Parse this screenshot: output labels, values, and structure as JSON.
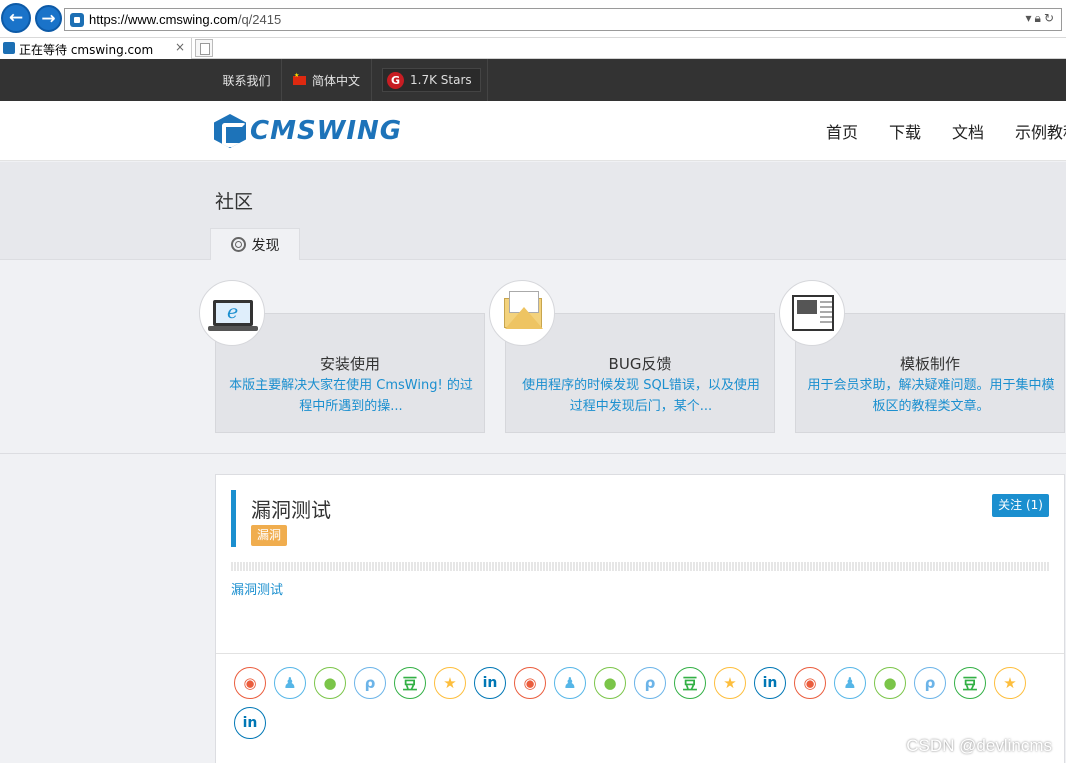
{
  "browser": {
    "url_prefix": "https://www.cmswing.com",
    "url_suffix": "/q/2415",
    "tab_title": "正在等待 cmswing.com",
    "tab_close": "×"
  },
  "topbar": {
    "contact": "联系我们",
    "language": "简体中文",
    "stars": "1.7K Stars",
    "gitee_letter": "G"
  },
  "header": {
    "logo_text": "CMSWING",
    "nav": [
      "首页",
      "下载",
      "文档",
      "示例教程"
    ]
  },
  "section": {
    "title": "社区",
    "tab": "发现"
  },
  "categories": [
    {
      "title": "安装使用",
      "desc": "本版主要解决大家在使用 CmsWing! 的过程中所遇到的操...",
      "icon": "laptop-icon"
    },
    {
      "title": "BUG反馈",
      "desc": "使用程序的时候发现 SQL错误，以及使用过程中发现后门，某个...",
      "icon": "mail-icon"
    },
    {
      "title": "模板制作",
      "desc": "用于会员求助，解决疑难问题。用于集中模板区的教程类文章。",
      "icon": "template-icon"
    }
  ],
  "post": {
    "title": "漏洞测试",
    "tag": "漏洞",
    "follow": "关注 (1)",
    "body": "漏洞测试"
  },
  "share_icons": [
    {
      "name": "weibo-icon",
      "glyph": "◉",
      "cls": "si-weibo"
    },
    {
      "name": "qq-icon",
      "glyph": "♟",
      "cls": "si-qq"
    },
    {
      "name": "wechat-icon",
      "glyph": "●",
      "cls": "si-wechat"
    },
    {
      "name": "tencent-weibo-icon",
      "glyph": "ρ",
      "cls": "si-tencent"
    },
    {
      "name": "douban-icon",
      "glyph": "豆",
      "cls": "si-douban"
    },
    {
      "name": "qzone-icon",
      "glyph": "★",
      "cls": "si-qzone"
    },
    {
      "name": "linkedin-icon",
      "glyph": "in",
      "cls": "si-linkedin"
    },
    {
      "name": "weibo-icon",
      "glyph": "◉",
      "cls": "si-weibo"
    },
    {
      "name": "qq-icon",
      "glyph": "♟",
      "cls": "si-qq"
    },
    {
      "name": "wechat-icon",
      "glyph": "●",
      "cls": "si-wechat"
    },
    {
      "name": "tencent-weibo-icon",
      "glyph": "ρ",
      "cls": "si-tencent"
    },
    {
      "name": "douban-icon",
      "glyph": "豆",
      "cls": "si-douban"
    },
    {
      "name": "qzone-icon",
      "glyph": "★",
      "cls": "si-qzone"
    },
    {
      "name": "linkedin-icon",
      "glyph": "in",
      "cls": "si-linkedin"
    },
    {
      "name": "weibo-icon",
      "glyph": "◉",
      "cls": "si-weibo"
    },
    {
      "name": "qq-icon",
      "glyph": "♟",
      "cls": "si-qq"
    },
    {
      "name": "wechat-icon",
      "glyph": "●",
      "cls": "si-wechat"
    },
    {
      "name": "tencent-weibo-icon",
      "glyph": "ρ",
      "cls": "si-tencent"
    },
    {
      "name": "douban-icon",
      "glyph": "豆",
      "cls": "si-douban"
    },
    {
      "name": "qzone-icon",
      "glyph": "★",
      "cls": "si-qzone"
    },
    {
      "name": "linkedin-icon",
      "glyph": "in",
      "cls": "si-linkedin"
    }
  ],
  "watermark": "CSDN @devlincms",
  "colors": {
    "accent": "#1b8fcf",
    "topbar": "#333333",
    "tag": "#f0ad4e",
    "brand": "#1d73b9"
  }
}
